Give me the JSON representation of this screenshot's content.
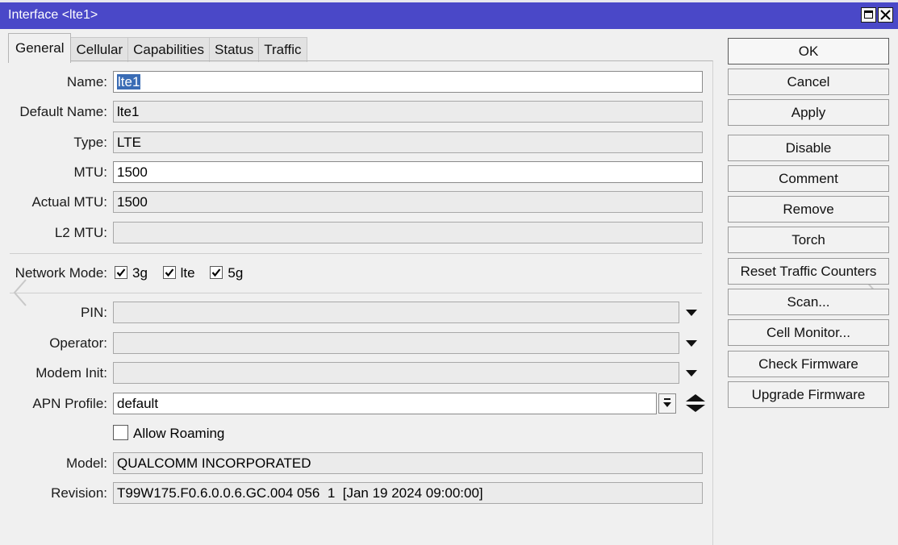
{
  "window": {
    "title": "Interface <lte1>"
  },
  "tabs": [
    {
      "label": "General"
    },
    {
      "label": "Cellular"
    },
    {
      "label": "Capabilities"
    },
    {
      "label": "Status"
    },
    {
      "label": "Traffic"
    }
  ],
  "fields": {
    "name": {
      "label": "Name:",
      "value": "lte1"
    },
    "default_name": {
      "label": "Default Name:",
      "value": "lte1"
    },
    "type": {
      "label": "Type:",
      "value": "LTE"
    },
    "mtu": {
      "label": "MTU:",
      "value": "1500"
    },
    "actual_mtu": {
      "label": "Actual MTU:",
      "value": "1500"
    },
    "l2_mtu": {
      "label": "L2 MTU:",
      "value": ""
    },
    "network_mode": {
      "label": "Network Mode:",
      "options": [
        {
          "label": "3g",
          "checked": true
        },
        {
          "label": "lte",
          "checked": true
        },
        {
          "label": "5g",
          "checked": true
        }
      ]
    },
    "pin": {
      "label": "PIN:",
      "value": ""
    },
    "operator": {
      "label": "Operator:",
      "value": ""
    },
    "modem_init": {
      "label": "Modem Init:",
      "value": ""
    },
    "apn_profile": {
      "label": "APN Profile:",
      "value": "default"
    },
    "allow_roaming": {
      "label": "Allow Roaming",
      "checked": false
    },
    "model": {
      "label": "Model:",
      "value": "QUALCOMM INCORPORATED"
    },
    "revision": {
      "label": "Revision:",
      "value": "T99W175.F0.6.0.0.6.GC.004 056  1  [Jan 19 2024 09:00:00]"
    }
  },
  "buttons": {
    "ok": "OK",
    "cancel": "Cancel",
    "apply": "Apply",
    "disable": "Disable",
    "comment": "Comment",
    "remove": "Remove",
    "torch": "Torch",
    "reset_traffic": "Reset Traffic Counters",
    "scan": "Scan...",
    "cell_monitor": "Cell Monitor...",
    "check_firmware": "Check Firmware",
    "upgrade_firmware": "Upgrade Firmware"
  },
  "colors": {
    "titlebar": "#4a48c8",
    "selection": "#3a6cb5"
  }
}
